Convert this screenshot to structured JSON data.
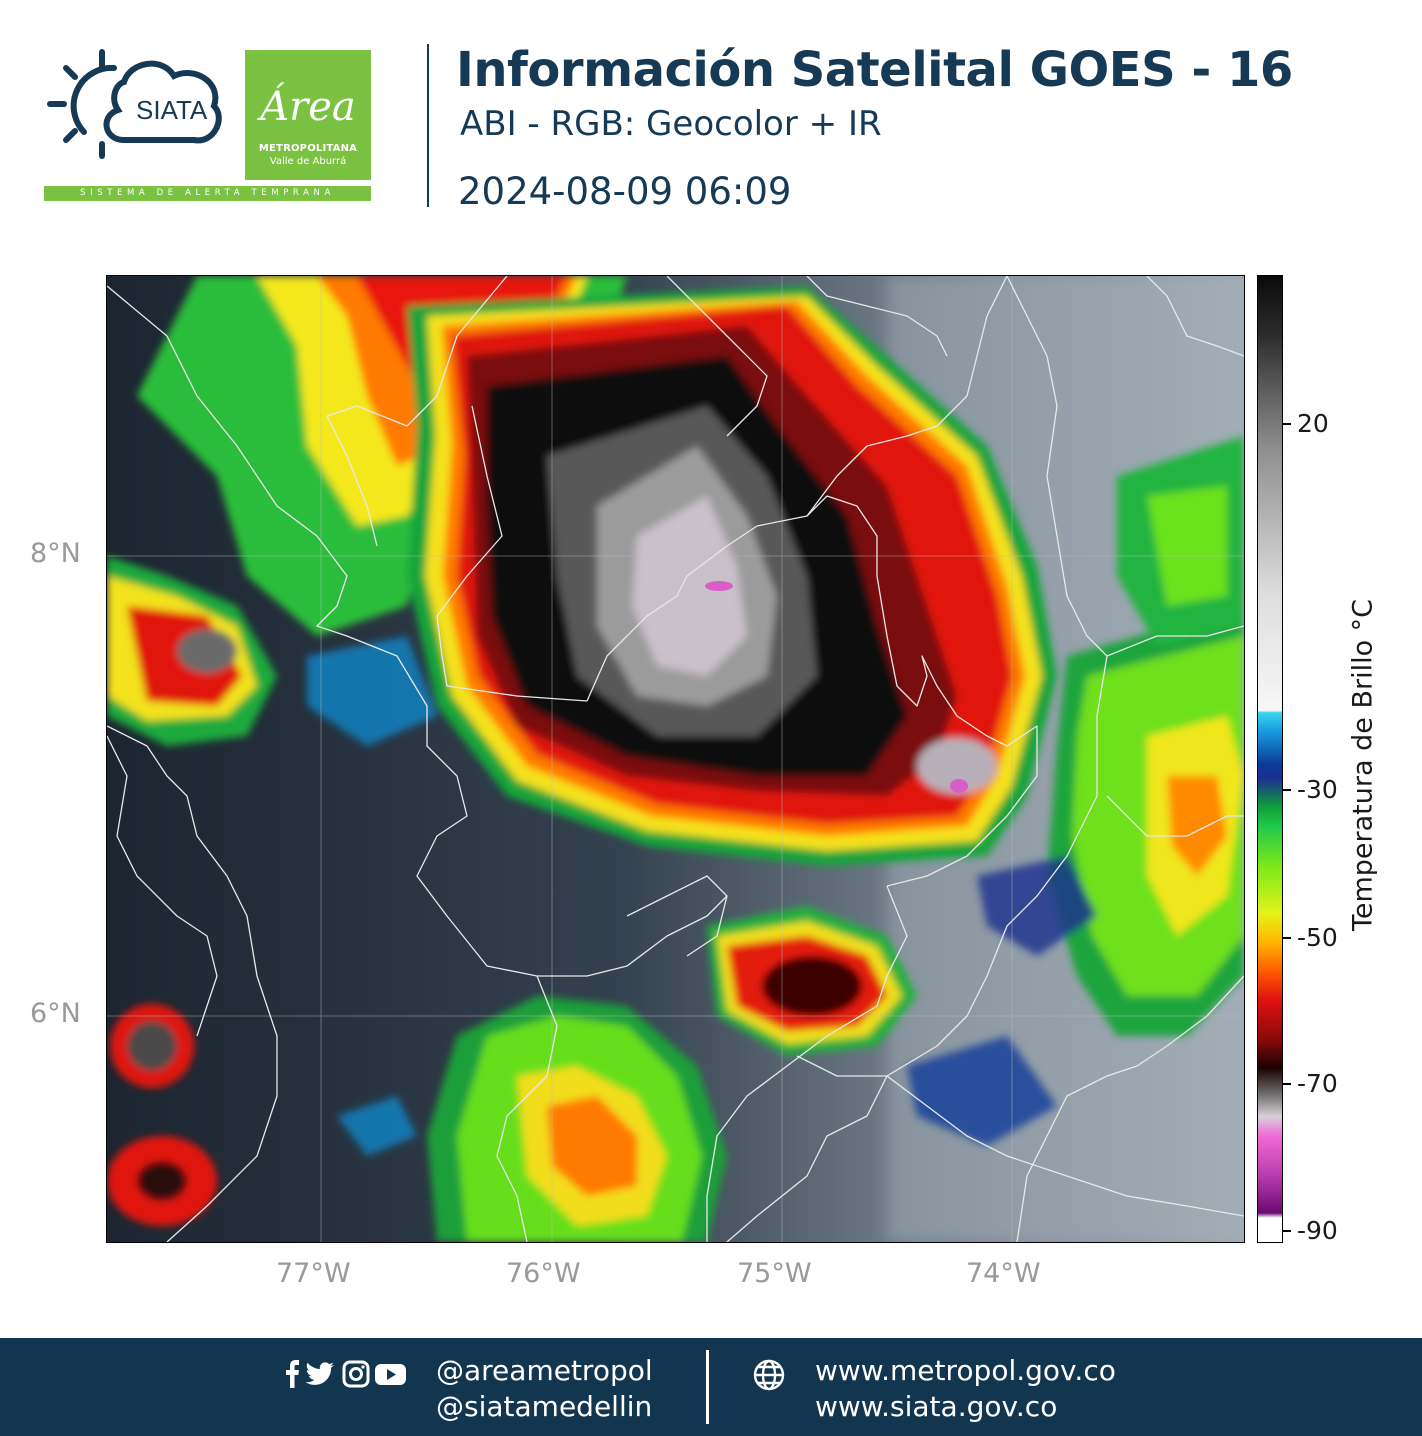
{
  "header": {
    "logo_siata_text": "SIATA",
    "logo_area_script": "Área",
    "logo_area_line1": "METROPOLITANA",
    "logo_area_line2": "Valle de Aburrá",
    "logo_tagline": "SISTEMA DE ALERTA TEMPRANA",
    "title": "Información Satelital GOES - 16",
    "subtitle": "ABI - RGB: Geocolor + IR",
    "datetime": "2024-08-09 06:09"
  },
  "map": {
    "lat_labels": [
      "8°N",
      "6°N"
    ],
    "lon_labels": [
      "77°W",
      "76°W",
      "75°W",
      "74°W"
    ]
  },
  "colorbar": {
    "title": "Temperatura de Brillo °C",
    "tick_labels": [
      "20",
      "-30",
      "-50",
      "-70",
      "-90"
    ]
  },
  "footer": {
    "handles": [
      "@areametropol",
      "@siatamedellin"
    ],
    "websites": [
      "www.metropol.gov.co",
      "www.siata.gov.co"
    ],
    "icons": [
      "facebook-icon",
      "twitter-icon",
      "instagram-icon",
      "youtube-icon",
      "globe-icon"
    ]
  },
  "colors": {
    "navy": "#163a55",
    "footer_bg": "#133650",
    "green": "#7cc242"
  }
}
